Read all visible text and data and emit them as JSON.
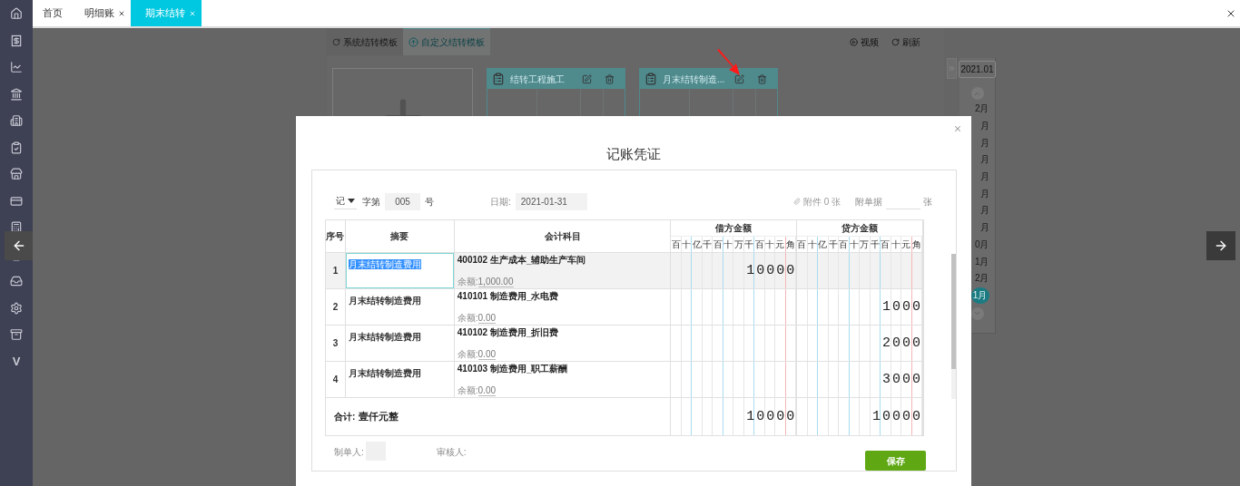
{
  "tabs": [
    {
      "label": "首页",
      "closable": false,
      "selected": false
    },
    {
      "label": "明细账",
      "closable": true,
      "selected": false
    },
    {
      "label": "期末结转",
      "closable": true,
      "selected": true
    }
  ],
  "sidebar": {
    "logo_text": "V"
  },
  "background": {
    "template_tabs": [
      {
        "label": "系统结转模板",
        "selected": false
      },
      {
        "label": "自定义结转模板",
        "selected": true
      }
    ],
    "actions": [
      {
        "label": "视频",
        "kind": "video"
      },
      {
        "label": "刷新",
        "kind": "refresh"
      }
    ],
    "cards": [
      {
        "title": "结转工程施工"
      },
      {
        "title": "月末结转制造..."
      }
    ],
    "period": "2021.01",
    "months": [
      {
        "label": "2月",
        "selected": false
      },
      {
        "label": "月",
        "selected": false
      },
      {
        "label": "月",
        "selected": false
      },
      {
        "label": "月",
        "selected": false
      },
      {
        "label": "月",
        "selected": false
      },
      {
        "label": "月",
        "selected": false
      },
      {
        "label": "月",
        "selected": false
      },
      {
        "label": "月",
        "selected": false
      },
      {
        "label": "0月",
        "selected": false
      },
      {
        "label": "1月",
        "selected": false
      },
      {
        "label": "2月",
        "selected": false
      },
      {
        "label": "1月",
        "selected": true
      }
    ]
  },
  "voucher": {
    "title": "记账凭证",
    "word": "记",
    "word_label": "字第",
    "number": "005",
    "number_suffix": "号",
    "date_label": "日期:",
    "date": "2021-01-31",
    "attachment": "附件 0 张",
    "attach_docs_label": "附单据",
    "attach_docs_unit": "张",
    "columns": {
      "index": "序号",
      "summary": "摘要",
      "account": "会计科目",
      "debit": "借方金额",
      "credit": "贷方金额"
    },
    "debit_units": [
      "百",
      "十",
      "亿",
      "千",
      "百",
      "十",
      "万",
      "千",
      "百",
      "十",
      "元",
      "角"
    ],
    "credit_units": [
      "百",
      "十",
      "亿",
      "千",
      "百",
      "十",
      "万",
      "千",
      "百",
      "十",
      "元",
      "角"
    ],
    "rows": [
      {
        "index": "1",
        "summary": "月末结转制造费用",
        "account": "400102 生产成本_辅助生产车间",
        "balance_label": "余额:",
        "balance": "1,000.00",
        "debit": "10000",
        "selected": true
      },
      {
        "index": "2",
        "summary": "月末结转制造费用",
        "account": "410101 制造费用_水电费",
        "balance_label": "余额:",
        "balance": "0.00",
        "credit": "1000",
        "selected": false
      },
      {
        "index": "3",
        "summary": "月末结转制造费用",
        "account": "410102 制造费用_折旧费",
        "balance_label": "余额:",
        "balance": "0.00",
        "credit": "2000",
        "selected": false
      },
      {
        "index": "4",
        "summary": "月末结转制造费用",
        "account": "410103 制造费用_职工薪酬",
        "balance_label": "余额:",
        "balance": "0.00",
        "credit": "3000",
        "selected": false
      }
    ],
    "total": {
      "label": "合计:",
      "words": "壹仟元整",
      "debit": "10000",
      "credit": "10000"
    },
    "maker_label": "制单人:",
    "reviewer_label": "审核人:",
    "save": "保存"
  }
}
